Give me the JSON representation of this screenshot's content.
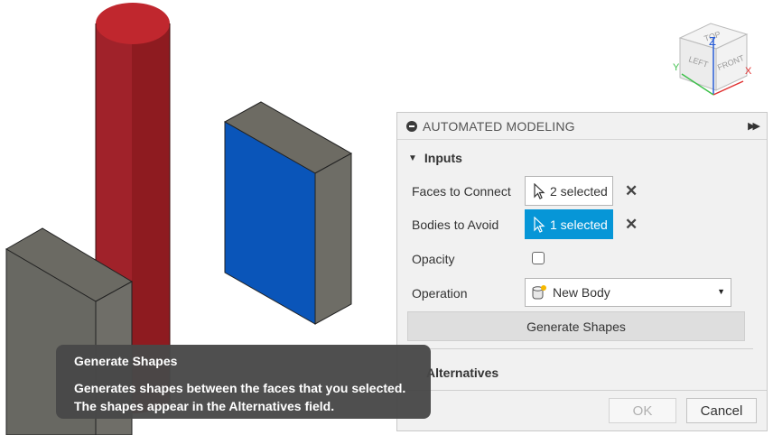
{
  "dialog": {
    "title": "AUTOMATED MODELING",
    "inputs_section": "Inputs",
    "faces_to_connect": {
      "label": "Faces to Connect",
      "value": "2 selected"
    },
    "bodies_to_avoid": {
      "label": "Bodies to Avoid",
      "value": "1 selected"
    },
    "opacity": {
      "label": "Opacity",
      "checked": false
    },
    "operation": {
      "label": "Operation",
      "value": "New Body"
    },
    "generate_button": "Generate Shapes",
    "alternatives_section": "Alternatives",
    "ok_label": "OK",
    "cancel_label": "Cancel"
  },
  "tooltip": {
    "title": "Generate Shapes",
    "body": "Generates shapes between the faces that you selected. The shapes appear in the Alternatives field."
  },
  "viewcube": {
    "top": "TOP",
    "left": "LEFT",
    "front": "FRONT",
    "axis_x": "X",
    "axis_y": "Y",
    "axis_z": "Z"
  },
  "colors": {
    "cylinder": "#b3222a",
    "selected_face": "#0a55b9",
    "box_gray": "#6e6e68",
    "selection_blue": "#0696d7"
  }
}
